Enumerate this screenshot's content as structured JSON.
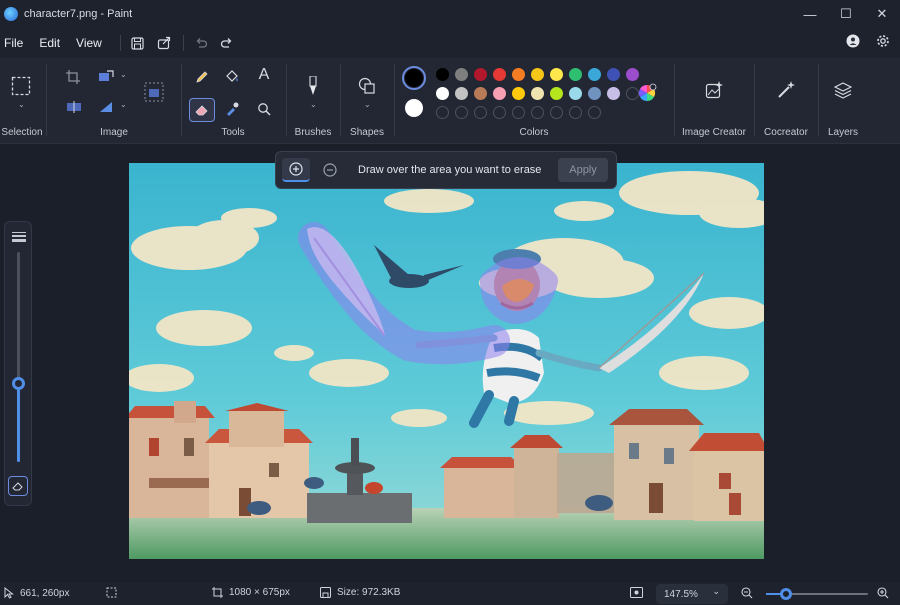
{
  "window": {
    "title": "character7.png - Paint"
  },
  "menu": {
    "file": "File",
    "edit": "Edit",
    "view": "View"
  },
  "ribbon": {
    "selection": "Selection",
    "image": "Image",
    "tools": "Tools",
    "brushes": "Brushes",
    "shapes": "Shapes",
    "colors": "Colors",
    "image_creator": "Image Creator",
    "cocreator": "Cocreator",
    "layers": "Layers"
  },
  "colors": {
    "primary": "#000000",
    "secondary": "#ffffff",
    "row1": [
      "#000000",
      "#7f7f7f",
      "#b2182b",
      "#e53935",
      "#f57c22",
      "#f5c518",
      "#fde74c",
      "#2fbf71",
      "#3aa7d8",
      "#3f51b5",
      "#9c4dcc"
    ],
    "row2": [
      "#ffffff",
      "#c3c3c3",
      "#b97a57",
      "#f7a0b4",
      "#ffc90e",
      "#efe4b0",
      "#b5e61d",
      "#99d9ea",
      "#7092be",
      "#c8bfe7",
      "empty"
    ]
  },
  "erase_toolbar": {
    "message": "Draw over the area you want to erase",
    "apply": "Apply"
  },
  "status": {
    "cursor": "661, 260px",
    "dimensions": "1080 × 675px",
    "size": "Size: 972.3KB",
    "zoom": "147.5%"
  }
}
